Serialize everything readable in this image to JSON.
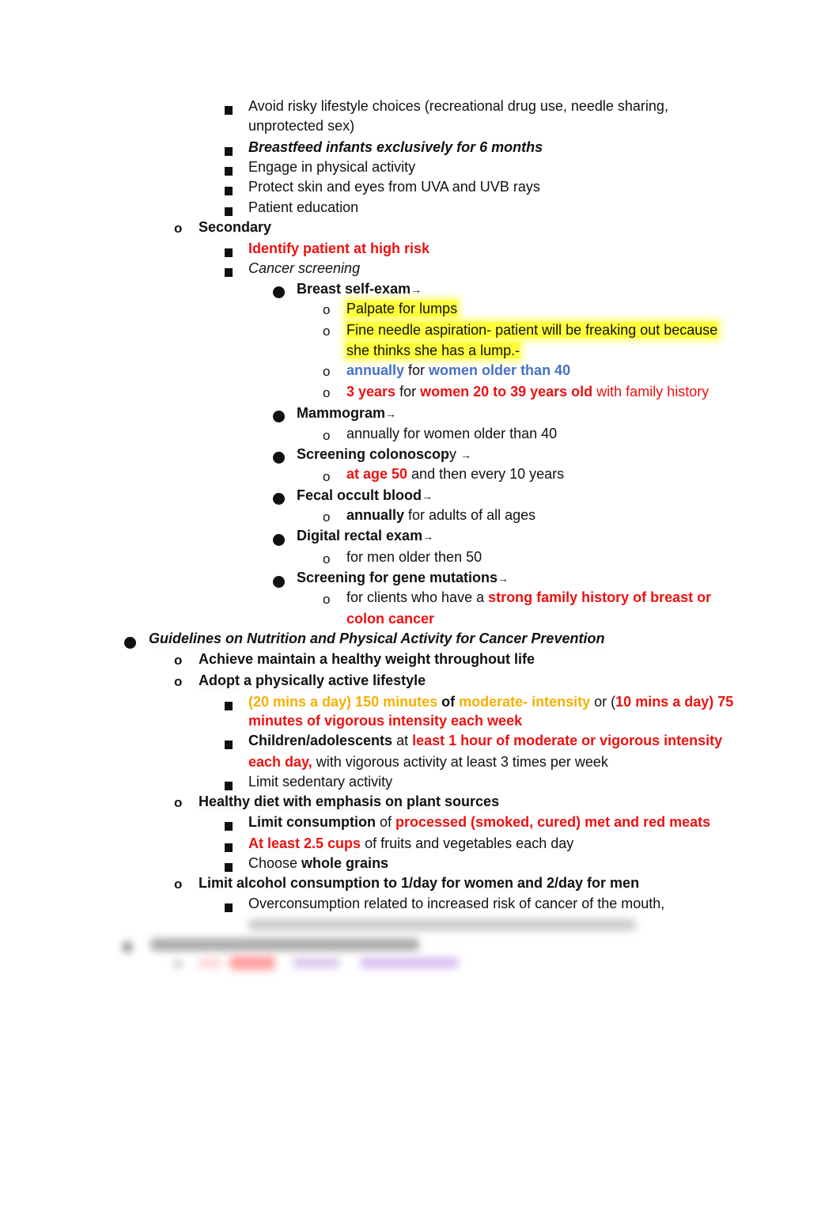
{
  "primary_items": [
    {
      "text": "Avoid risky lifestyle choices (recreational drug use, needle sharing,",
      "cont": "unprotected sex)"
    },
    {
      "text": "Breastfeed infants exclusively for 6 months"
    },
    {
      "text": "Engage in physical activity"
    },
    {
      "text": "Protect skin and eyes from UVA and UVB rays"
    },
    {
      "text": "Patient education"
    }
  ],
  "secondary": {
    "label": "Secondary",
    "identify": "Identify patient at high risk",
    "screening_label": "Cancer screening",
    "breast": {
      "label": "Breast self-exam",
      "palpate": "Palpate for lumps",
      "fna_1": "Fine needle aspiration- patient will be freaking out because",
      "fna_2": "she thinks she has a lump.-",
      "annual_a": "annually",
      "annual_b": " for ",
      "annual_c": "women older than 40",
      "three_a": "3 years",
      "three_b": " for ",
      "three_c": "women 20 to 39 years old",
      "three_d": " with family history"
    },
    "mammogram": {
      "label": "Mammogram",
      "detail": "annually for women older than 40"
    },
    "colonoscopy": {
      "label": "Screening colonoscop",
      "label_tail": "y",
      "detail_a": "at age 50",
      "detail_b": " and then every 10 years"
    },
    "fecal": {
      "label": "Fecal occult blood",
      "detail_a": "annually",
      "detail_b": " for adults of all ages"
    },
    "rectal": {
      "label": "Digital rectal exam",
      "detail": "for men older then 50"
    },
    "gene": {
      "label": "Screening for gene mutations",
      "detail_a": "for clients who have a ",
      "detail_b": "strong family history of breast or",
      "detail_c": "colon cancer"
    }
  },
  "guidelines": {
    "title": "Guidelines on Nutrition and Physical Activity for Cancer Prevention",
    "weight": "Achieve maintain a healthy weight throughout life",
    "active": {
      "label": "Adopt a physically active lifestyle",
      "l1_a": "(20 mins a day) 150 minutes",
      "l1_b": " of ",
      "l1_c": "moderate- intensity",
      "l1_d": " or (",
      "l1_e": "10 mins a day) 75",
      "l1_f": "minutes of vigorous intensity each week",
      "kids_a": "Children/adolescents",
      "kids_b": " at ",
      "kids_c": "least 1 hour of moderate or vigorous intensity",
      "kids_d": "each day,",
      "kids_e": " with vigorous activity at least 3 times per week",
      "sedentary": "Limit sedentary activity"
    },
    "diet": {
      "label": "Healthy diet with emphasis on plant sources",
      "limit_a": "Limit consumption",
      "limit_b": " of ",
      "limit_c": "processed (smoked, cured) met and red meats",
      "cups_a": "At least 2.5 cups",
      "cups_b": " of fruits and vegetables each day",
      "grains_a": "Choose ",
      "grains_b": "whole grains"
    },
    "alcohol": {
      "label": "Limit alcohol consumption to 1/day for women and 2/day for men",
      "detail": "Overconsumption related to increased risk of cancer of the mouth,"
    }
  },
  "symbols": {
    "arrow": "→",
    "circle": "o"
  }
}
